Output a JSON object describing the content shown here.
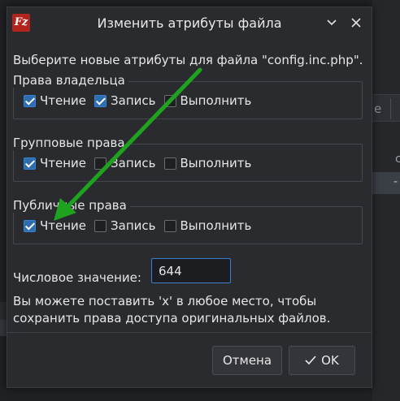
{
  "dialog": {
    "title": "Изменить атрибуты файла",
    "app_icon": "Fz",
    "prompt": "Выберите новые атрибуты для файла \"config.inc.php\".",
    "groups": [
      {
        "title": "Права владельца",
        "read": "Чтение",
        "write": "Запись",
        "execute": "Выполнить",
        "checked": [
          true,
          true,
          false
        ]
      },
      {
        "title": "Групповые права",
        "read": "Чтение",
        "write": "Запись",
        "execute": "Выполнить",
        "checked": [
          true,
          false,
          false
        ]
      },
      {
        "title": "Публичные права",
        "read": "Чтение",
        "write": "Запись",
        "execute": "Выполнить",
        "checked": [
          true,
          false,
          false
        ]
      }
    ],
    "numeric_label": "Числовое значение:",
    "numeric_value": "644",
    "hint": "Вы можете поставить 'x' в любое место, чтобы сохранить права доступа оригинальных файлов.",
    "cancel_label": "Отмена",
    "ok_label": "OK"
  },
  "background": {
    "text1": "e",
    "text2": "c",
    "text3": "-"
  },
  "colors": {
    "accent": "#2e6db0",
    "arrow": "#1fa31f",
    "dialog_bg": "#2a2b2e"
  }
}
